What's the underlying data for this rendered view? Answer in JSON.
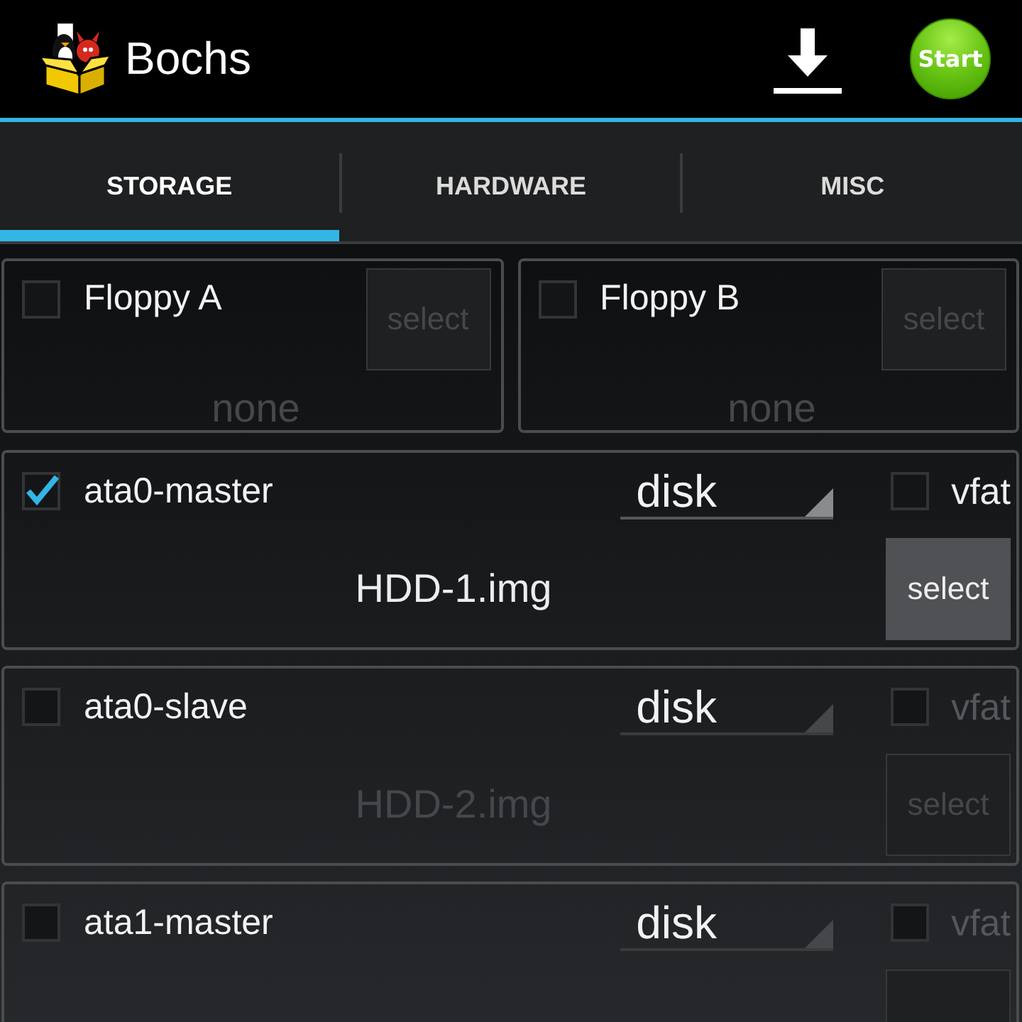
{
  "action_bar": {
    "title": "Bochs",
    "start_button": "Start"
  },
  "tabs": [
    {
      "label": "STORAGE",
      "selected": true
    },
    {
      "label": "HARDWARE",
      "selected": false
    },
    {
      "label": "MISC",
      "selected": false
    }
  ],
  "floppies": [
    {
      "label": "Floppy A",
      "checked": false,
      "button": "select",
      "file": "none"
    },
    {
      "label": "Floppy B",
      "checked": false,
      "button": "select",
      "file": "none"
    }
  ],
  "drives": [
    {
      "label": "ata0-master",
      "checked": true,
      "type": "disk",
      "vfat_label": "vfat",
      "vfat_checked": false,
      "file": "HDD-1.img",
      "button": "select"
    },
    {
      "label": "ata0-slave",
      "checked": false,
      "type": "disk",
      "vfat_label": "vfat",
      "vfat_checked": false,
      "file": "HDD-2.img",
      "button": "select"
    },
    {
      "label": "ata1-master",
      "checked": false,
      "type": "disk",
      "vfat_label": "vfat",
      "vfat_checked": false
    }
  ]
}
